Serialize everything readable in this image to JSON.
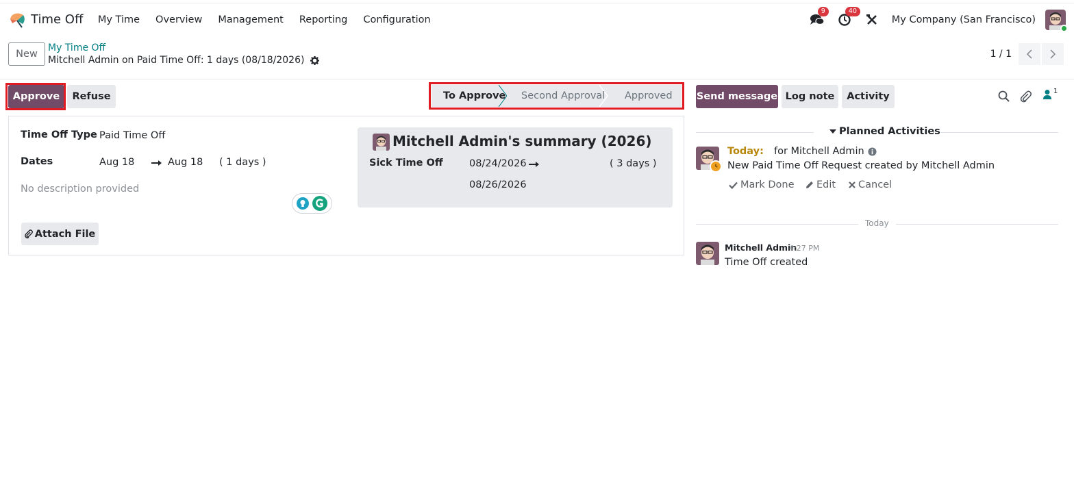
{
  "navbar": {
    "app_name": "Time Off",
    "menu": [
      "My Time",
      "Overview",
      "Management",
      "Reporting",
      "Configuration"
    ],
    "messages_count": "9",
    "activities_count": "40",
    "company": "My Company (San Francisco)"
  },
  "control_panel": {
    "new_label": "New",
    "breadcrumb_parent": "My Time Off",
    "breadcrumb_current": "Mitchell Admin on Paid Time Off: 1 days (08/18/2026)",
    "pager": "1 / 1"
  },
  "actions": {
    "approve": "Approve",
    "refuse": "Refuse"
  },
  "status": {
    "stages": [
      "To Approve",
      "Second Approval",
      "Approved"
    ],
    "current": "To Approve"
  },
  "form": {
    "type_label": "Time Off Type",
    "type_value": "Paid Time Off",
    "dates_label": "Dates",
    "date_from": "Aug 18",
    "date_to": "Aug 18",
    "duration": "( 1 days )",
    "description_placeholder": "No description provided",
    "attach_label": "Attach File"
  },
  "summary": {
    "title": "Mitchell Admin's summary (2026)",
    "row_label": "Sick Time Off",
    "row_from": "08/24/2026",
    "row_to": "08/26/2026",
    "row_duration": "( 3 days )"
  },
  "chatter": {
    "send_message": "Send message",
    "log_note": "Log note",
    "activity": "Activity",
    "followers_count": "1",
    "planned_title": "Planned Activities",
    "activity_due": "Today:",
    "activity_for": "for Mitchell Admin",
    "activity_summary": "New Paid Time Off Request created by Mitchell Admin",
    "mark_done": "Mark Done",
    "edit": "Edit",
    "cancel": "Cancel",
    "day_separator": "Today",
    "message_author": "Mitchell Admin",
    "message_time": "4:27 PM",
    "message_body": "Time Off created"
  },
  "colors": {
    "primary": "#714b67",
    "link": "#017e84",
    "highlight_frame": "#e01b24",
    "badge": "#d9363e",
    "today": "#b8860b"
  }
}
